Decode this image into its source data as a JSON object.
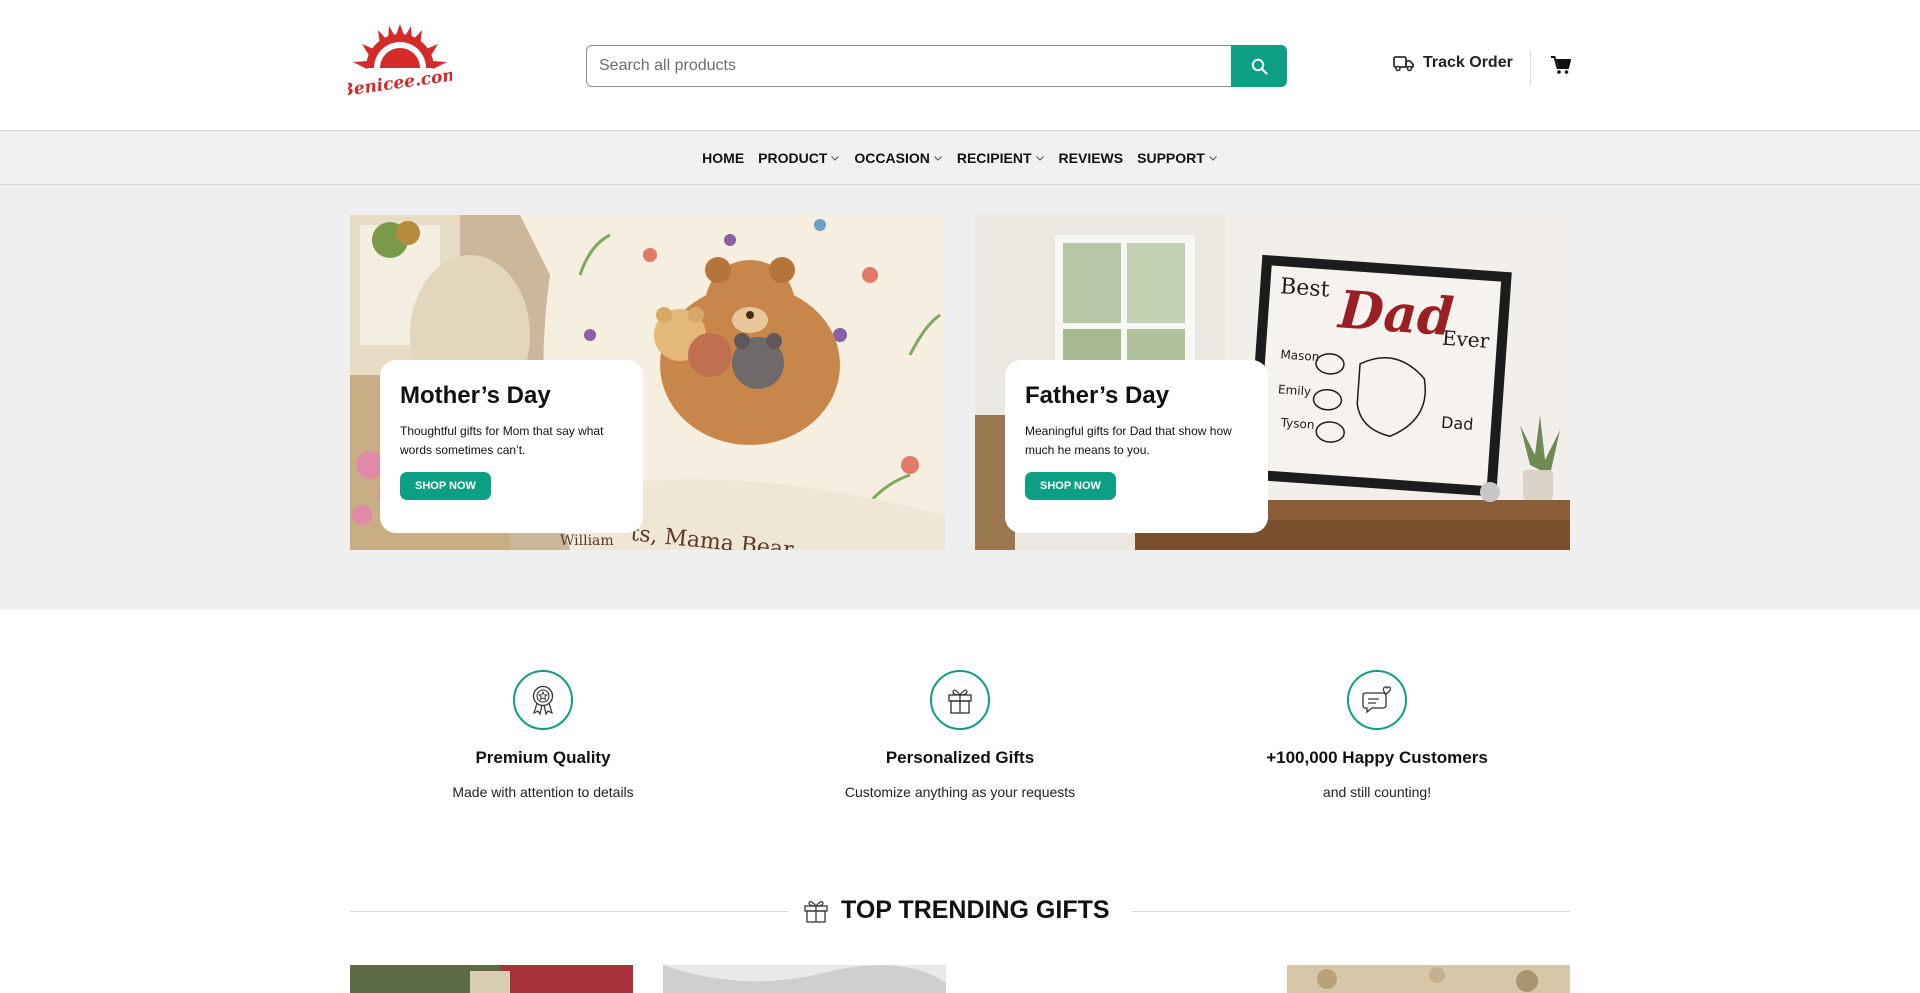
{
  "brand": {
    "logo_text": "Benicee.com",
    "accent": "#0d9f84",
    "logo_color": "#d42a2a"
  },
  "search": {
    "placeholder": "Search all products",
    "icon": "search-icon"
  },
  "header": {
    "track_label": "Track Order",
    "track_icon": "truck-icon",
    "cart_icon": "cart-icon"
  },
  "nav": {
    "items": [
      {
        "label": "HOME",
        "dropdown": false
      },
      {
        "label": "PRODUCT",
        "dropdown": true
      },
      {
        "label": "OCCASION",
        "dropdown": true
      },
      {
        "label": "RECIPIENT",
        "dropdown": true
      },
      {
        "label": "REVIEWS",
        "dropdown": false
      },
      {
        "label": "SUPPORT",
        "dropdown": true
      }
    ]
  },
  "banners": [
    {
      "title": "Mother’s Day",
      "text": "Thoughtful gifts for Mom that say what words sometimes can’t.",
      "button": "SHOP NOW",
      "image_text": "ts, Mama Bear",
      "image_text2": "William"
    },
    {
      "title": "Father’s Day",
      "text": "Meaningful gifts for Dad that show how much he means to you.",
      "button": "SHOP NOW",
      "image_text": {
        "best": "Best",
        "dad": "Dad",
        "ever": "Ever",
        "names": [
          "Mason",
          "Emily",
          "Tyson"
        ],
        "dad_small": "Dad"
      }
    }
  ],
  "features": [
    {
      "title": "Premium Quality",
      "text": "Made with attention to details",
      "icon": "award-badge-icon"
    },
    {
      "title": "Personalized Gifts",
      "text": "Customize anything as your requests",
      "icon": "gift-icon"
    },
    {
      "title": "+100,000 Happy Customers",
      "text": "and still counting!",
      "icon": "chat-heart-icon"
    }
  ],
  "trending": {
    "title": "TOP TRENDING GIFTS",
    "icon": "gift-icon"
  }
}
